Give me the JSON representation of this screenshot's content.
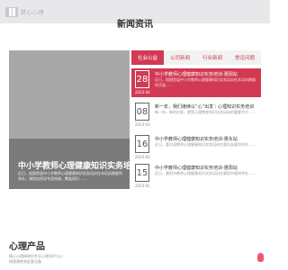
{
  "header": {
    "logo_text": "精心心理"
  },
  "news_section": {
    "title": "新闻资讯",
    "feature": {
      "title": "中小学教师心理健康知识实务培训",
      "desc": "近日，祖国首届中小学教师心理健康知识实务培训在本培训期顺利举办。课程由资深专家授课，覆盖知识……"
    },
    "tabs": [
      {
        "label": "社会公益",
        "active": true
      },
      {
        "label": "公司新闻",
        "active": false
      },
      {
        "label": "行业新闻",
        "active": false
      },
      {
        "label": "常见问题",
        "active": false
      }
    ],
    "items": [
      {
        "day": "28",
        "year_month": "2023-04",
        "title": "中小学教师心理健康知识实务培训-惠阳站",
        "desc": "近日，祖国首届中小学教师心理健康知识实务培训在本培训期顺利开展……"
      },
      {
        "day": "08",
        "year_month": "2023-03",
        "title": "新一年，我们继续以“心”出发｜心理知识实务培训",
        "desc": "新一年，新的出发，更是心理教育知识实务培训的重要节点……"
      },
      {
        "day": "16",
        "year_month": "2023-02",
        "title": "中小学教师心理健康知识实务培训-惠东站",
        "desc": "近日，惠东县教师心理健康知识实务培训在惠东县顺利举办……"
      },
      {
        "day": "15",
        "year_month": "2023-01",
        "title": "中小学教师心理健康知识实务培训-惠阳站",
        "desc": "近日，惠阳市教师心理健康知识实务培训在惠阳市顺利举办……"
      }
    ]
  },
  "products": {
    "title": "心理产品",
    "desc": "精心心理精神科专业心理测评与心理健康教育配套设备"
  },
  "colors": {
    "accent": "#d13a52",
    "float_button": "#ea5a72"
  }
}
